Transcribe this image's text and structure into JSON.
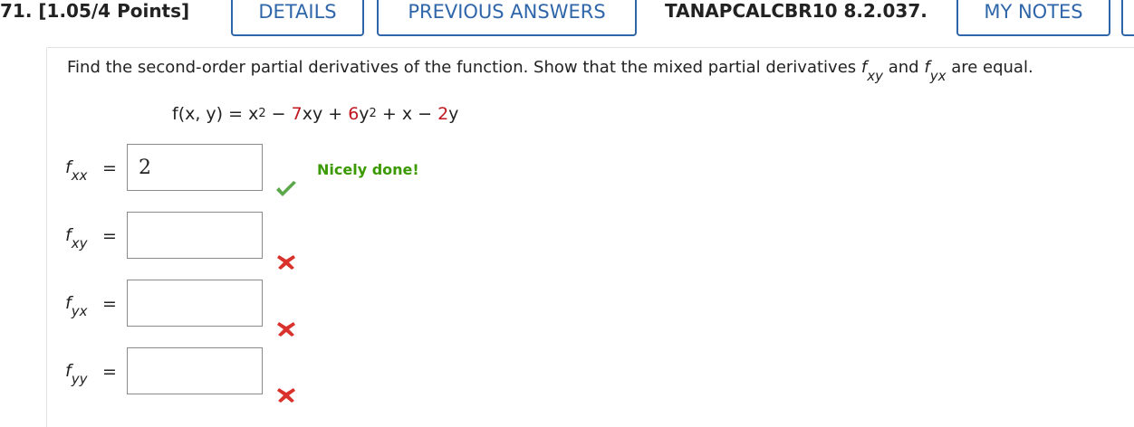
{
  "header": {
    "question_label": "71. [1.05/4 Points]",
    "details_label": "DETAILS",
    "previous_answers_label": "PREVIOUS ANSWERS",
    "reference": "TANAPCALCBR10 8.2.037.",
    "my_notes_label": "MY NOTES"
  },
  "question": {
    "prompt_start": "Find the second-order partial derivatives of the function. Show that the mixed partial derivatives",
    "f_letter": "f",
    "sub_xy": "xy",
    "and_word": "and",
    "sub_yx": "yx",
    "prompt_end": "are equal.",
    "equation": {
      "lhs": "f(x, y) = x",
      "exp1": "2",
      "op1": " − ",
      "coef1": "7",
      "term1": "xy",
      "op2": " + ",
      "coef2": "6",
      "term2": "y",
      "exp2": "2",
      "op3": " + x − ",
      "coef3": "2",
      "term3": "y"
    }
  },
  "answers": [
    {
      "f_letter": "f",
      "sub": "xx",
      "equals": "=",
      "value": "2",
      "status": "correct",
      "status_icon": "checkmark-icon"
    },
    {
      "f_letter": "f",
      "sub": "xy",
      "equals": "=",
      "value": "",
      "status": "incorrect",
      "status_icon": "x-mark-icon"
    },
    {
      "f_letter": "f",
      "sub": "yx",
      "equals": "=",
      "value": "",
      "status": "incorrect",
      "status_icon": "x-mark-icon"
    },
    {
      "f_letter": "f",
      "sub": "yy",
      "equals": "=",
      "value": "",
      "status": "incorrect",
      "status_icon": "x-mark-icon"
    }
  ],
  "feedback": {
    "text": "Nicely done!",
    "color": "#3a9a00"
  },
  "colors": {
    "accent": "#2f66a9",
    "red": "#c0161f",
    "check": "#5aa84a",
    "x_mark": "#d9312c"
  }
}
